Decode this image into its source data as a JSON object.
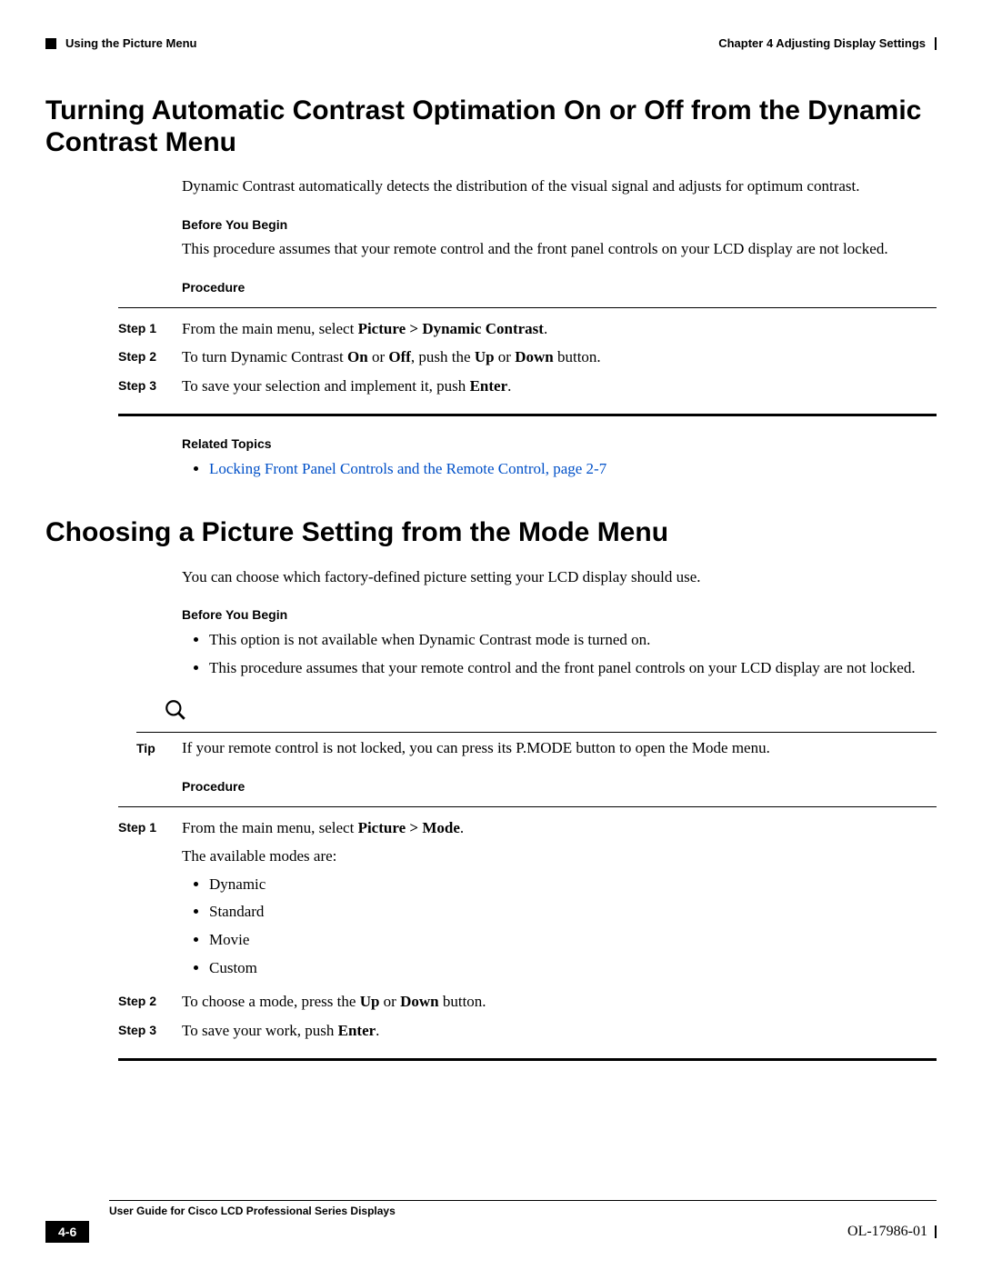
{
  "header": {
    "left_marker": "■",
    "section_path": "Using the Picture Menu",
    "chapter": "Chapter 4      Adjusting Display Settings"
  },
  "section1": {
    "title": "Turning Automatic Contrast Optimation On or Off from the Dynamic Contrast Menu",
    "intro": "Dynamic Contrast automatically detects the distribution of the visual signal and adjusts for optimum contrast.",
    "before_label": "Before You Begin",
    "before_text": "This procedure assumes that your remote control and the front panel controls on your LCD display are not locked.",
    "procedure_label": "Procedure",
    "steps": [
      {
        "label": "Step 1",
        "html": "From the main menu, select <b>Picture > Dynamic Contrast</b>."
      },
      {
        "label": "Step 2",
        "html": "To turn Dynamic Contrast <b>On</b> or <b>Off</b>, push the <b>Up</b> or <b>Down</b> button."
      },
      {
        "label": "Step 3",
        "html": "To save your selection and implement it, push <b>Enter</b>."
      }
    ],
    "related_label": "Related Topics",
    "related_link": "Locking Front Panel Controls and the Remote Control, page 2-7"
  },
  "section2": {
    "title": "Choosing a Picture Setting from the Mode Menu",
    "intro": "You can choose which factory-defined picture setting your LCD display should use.",
    "before_label": "Before You Begin",
    "before_bullets": [
      "This option is not available when Dynamic Contrast mode is turned on.",
      "This procedure assumes that your remote control and the front panel controls on your LCD display are not locked."
    ],
    "tip_label": "Tip",
    "tip_text": "If your remote control is not locked, you can press its P.MODE button to open the Mode menu.",
    "procedure_label": "Procedure",
    "steps": [
      {
        "label": "Step 1",
        "html": "From the main menu, select <b>Picture > Mode</b>.",
        "after": "The available modes are:",
        "modes": [
          "Dynamic",
          "Standard",
          "Movie",
          "Custom"
        ]
      },
      {
        "label": "Step 2",
        "html": "To choose a mode, press the <b>Up</b> or <b>Down</b> button."
      },
      {
        "label": "Step 3",
        "html": "To save your work, push <b>Enter</b>."
      }
    ]
  },
  "footer": {
    "book_title": "User Guide for Cisco LCD Professional Series Displays",
    "page_num": "4-6",
    "doc_id": "OL-17986-01"
  }
}
